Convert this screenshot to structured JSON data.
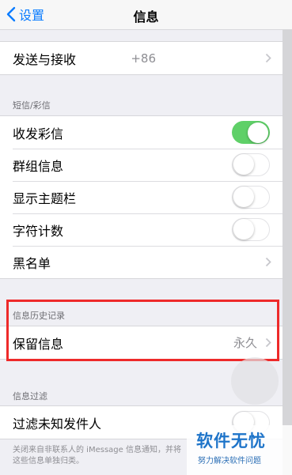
{
  "nav": {
    "back_label": "设置",
    "title": "信息"
  },
  "send_receive": {
    "label": "发送与接收",
    "value": "+86"
  },
  "sms_section": {
    "header": "短信/彩信",
    "rows": [
      {
        "label": "收发彩信",
        "toggle": "on"
      },
      {
        "label": "群组信息",
        "toggle": "off"
      },
      {
        "label": "显示主题栏",
        "toggle": "off"
      },
      {
        "label": "字符计数",
        "toggle": "off"
      },
      {
        "label": "黑名单"
      }
    ]
  },
  "history_section": {
    "header": "信息历史记录",
    "keep_label": "保留信息",
    "keep_value": "永久"
  },
  "filter_section": {
    "header": "信息过滤",
    "filter_label": "过滤未知发件人",
    "filter_toggle": "off",
    "footer": "关闭来自非联系人的 iMessage 信息通知，并将这些信息单独归类。"
  },
  "watermark": {
    "title": "软件无忧",
    "subtitle": "努力解决软件问题"
  },
  "colors": {
    "accent": "#0a7cff",
    "toggle_on": "#5fd068",
    "highlight": "#ee2a2a",
    "watermark": "#1e74c9"
  }
}
